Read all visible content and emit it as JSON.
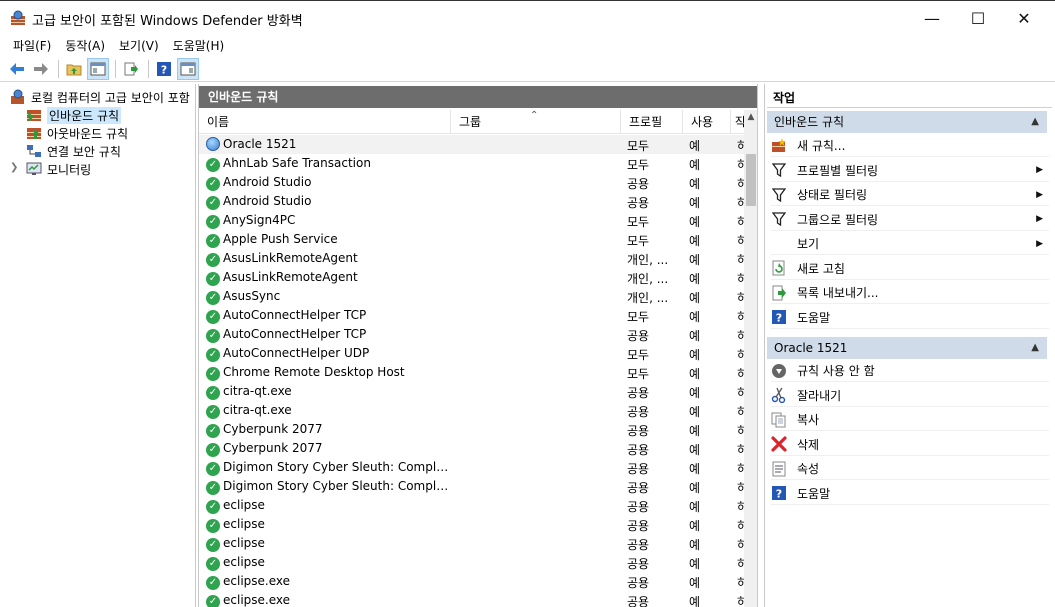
{
  "window": {
    "title": "고급 보안이 포함된 Windows Defender 방화벽",
    "minimize": "—",
    "maximize": "☐",
    "close": "✕"
  },
  "menu": [
    "파일(F)",
    "동작(A)",
    "보기(V)",
    "도움말(H)"
  ],
  "tree": {
    "root": "로컬 컴퓨터의 고급 보안이 포함",
    "items": [
      "인바운드 규칙",
      "아웃바운드 규칙",
      "연결 보안 규칙",
      "모니터링"
    ]
  },
  "center": {
    "header": "인바운드 규칙",
    "columns": [
      "이름",
      "그룹",
      "프로필",
      "사용",
      "작"
    ],
    "rows": [
      {
        "name": "Oracle 1521",
        "profile": "모두",
        "enabled": "예",
        "action": "허",
        "icon": "globe"
      },
      {
        "name": "AhnLab Safe Transaction",
        "profile": "모두",
        "enabled": "예",
        "action": "허",
        "icon": "check"
      },
      {
        "name": "Android Studio",
        "profile": "공용",
        "enabled": "예",
        "action": "허",
        "icon": "check"
      },
      {
        "name": "Android Studio",
        "profile": "공용",
        "enabled": "예",
        "action": "허",
        "icon": "check"
      },
      {
        "name": "AnySign4PC",
        "profile": "모두",
        "enabled": "예",
        "action": "허",
        "icon": "check"
      },
      {
        "name": "Apple Push Service",
        "profile": "모두",
        "enabled": "예",
        "action": "허",
        "icon": "check"
      },
      {
        "name": "AsusLinkRemoteAgent",
        "profile": "개인, ...",
        "enabled": "예",
        "action": "허",
        "icon": "check"
      },
      {
        "name": "AsusLinkRemoteAgent",
        "profile": "개인, ...",
        "enabled": "예",
        "action": "허",
        "icon": "check"
      },
      {
        "name": "AsusSync",
        "profile": "개인, ...",
        "enabled": "예",
        "action": "허",
        "icon": "check"
      },
      {
        "name": "AutoConnectHelper TCP",
        "profile": "모두",
        "enabled": "예",
        "action": "허",
        "icon": "check"
      },
      {
        "name": "AutoConnectHelper TCP",
        "profile": "공용",
        "enabled": "예",
        "action": "허",
        "icon": "check"
      },
      {
        "name": "AutoConnectHelper UDP",
        "profile": "모두",
        "enabled": "예",
        "action": "허",
        "icon": "check"
      },
      {
        "name": "Chrome Remote Desktop Host",
        "profile": "모두",
        "enabled": "예",
        "action": "허",
        "icon": "check"
      },
      {
        "name": "citra-qt.exe",
        "profile": "공용",
        "enabled": "예",
        "action": "허",
        "icon": "check"
      },
      {
        "name": "citra-qt.exe",
        "profile": "공용",
        "enabled": "예",
        "action": "허",
        "icon": "check"
      },
      {
        "name": "Cyberpunk 2077",
        "profile": "공용",
        "enabled": "예",
        "action": "허",
        "icon": "check"
      },
      {
        "name": "Cyberpunk 2077",
        "profile": "공용",
        "enabled": "예",
        "action": "허",
        "icon": "check"
      },
      {
        "name": "Digimon Story Cyber Sleuth: Complete ...",
        "profile": "공용",
        "enabled": "예",
        "action": "허",
        "icon": "check"
      },
      {
        "name": "Digimon Story Cyber Sleuth: Complete ...",
        "profile": "공용",
        "enabled": "예",
        "action": "허",
        "icon": "check"
      },
      {
        "name": "eclipse",
        "profile": "공용",
        "enabled": "예",
        "action": "허",
        "icon": "check"
      },
      {
        "name": "eclipse",
        "profile": "공용",
        "enabled": "예",
        "action": "허",
        "icon": "check"
      },
      {
        "name": "eclipse",
        "profile": "공용",
        "enabled": "예",
        "action": "허",
        "icon": "check"
      },
      {
        "name": "eclipse",
        "profile": "공용",
        "enabled": "예",
        "action": "허",
        "icon": "check"
      },
      {
        "name": "eclipse.exe",
        "profile": "공용",
        "enabled": "예",
        "action": "허",
        "icon": "check"
      },
      {
        "name": "eclipse.exe",
        "profile": "공용",
        "enabled": "예",
        "action": "허",
        "icon": "check"
      }
    ]
  },
  "actions": {
    "header": "작업",
    "section1": {
      "title": "인바운드 규칙",
      "items": [
        {
          "label": "새 규칙...",
          "icon": "new-rule-icon",
          "submenu": false
        },
        {
          "label": "프로필별 필터링",
          "icon": "filter-icon",
          "submenu": true
        },
        {
          "label": "상태로 필터링",
          "icon": "filter-icon",
          "submenu": true
        },
        {
          "label": "그룹으로 필터링",
          "icon": "filter-icon",
          "submenu": true
        },
        {
          "label": "보기",
          "icon": "",
          "submenu": true
        },
        {
          "label": "새로 고침",
          "icon": "refresh-icon",
          "submenu": false
        },
        {
          "label": "목록 내보내기...",
          "icon": "export-icon",
          "submenu": false
        },
        {
          "label": "도움말",
          "icon": "help-icon",
          "submenu": false
        }
      ]
    },
    "section2": {
      "title": "Oracle 1521",
      "items": [
        {
          "label": "규칙 사용 안 함",
          "icon": "disable-icon"
        },
        {
          "label": "잘라내기",
          "icon": "cut-icon"
        },
        {
          "label": "복사",
          "icon": "copy-icon"
        },
        {
          "label": "삭제",
          "icon": "delete-icon"
        },
        {
          "label": "속성",
          "icon": "properties-icon"
        },
        {
          "label": "도움말",
          "icon": "help-icon"
        }
      ]
    }
  },
  "colors": {
    "accent_selected": "#cce8ff",
    "section_bar": "#cfdbe8",
    "center_header": "#6d6d6d",
    "check_green": "#2ea44f",
    "delete_red": "#d9262c"
  }
}
